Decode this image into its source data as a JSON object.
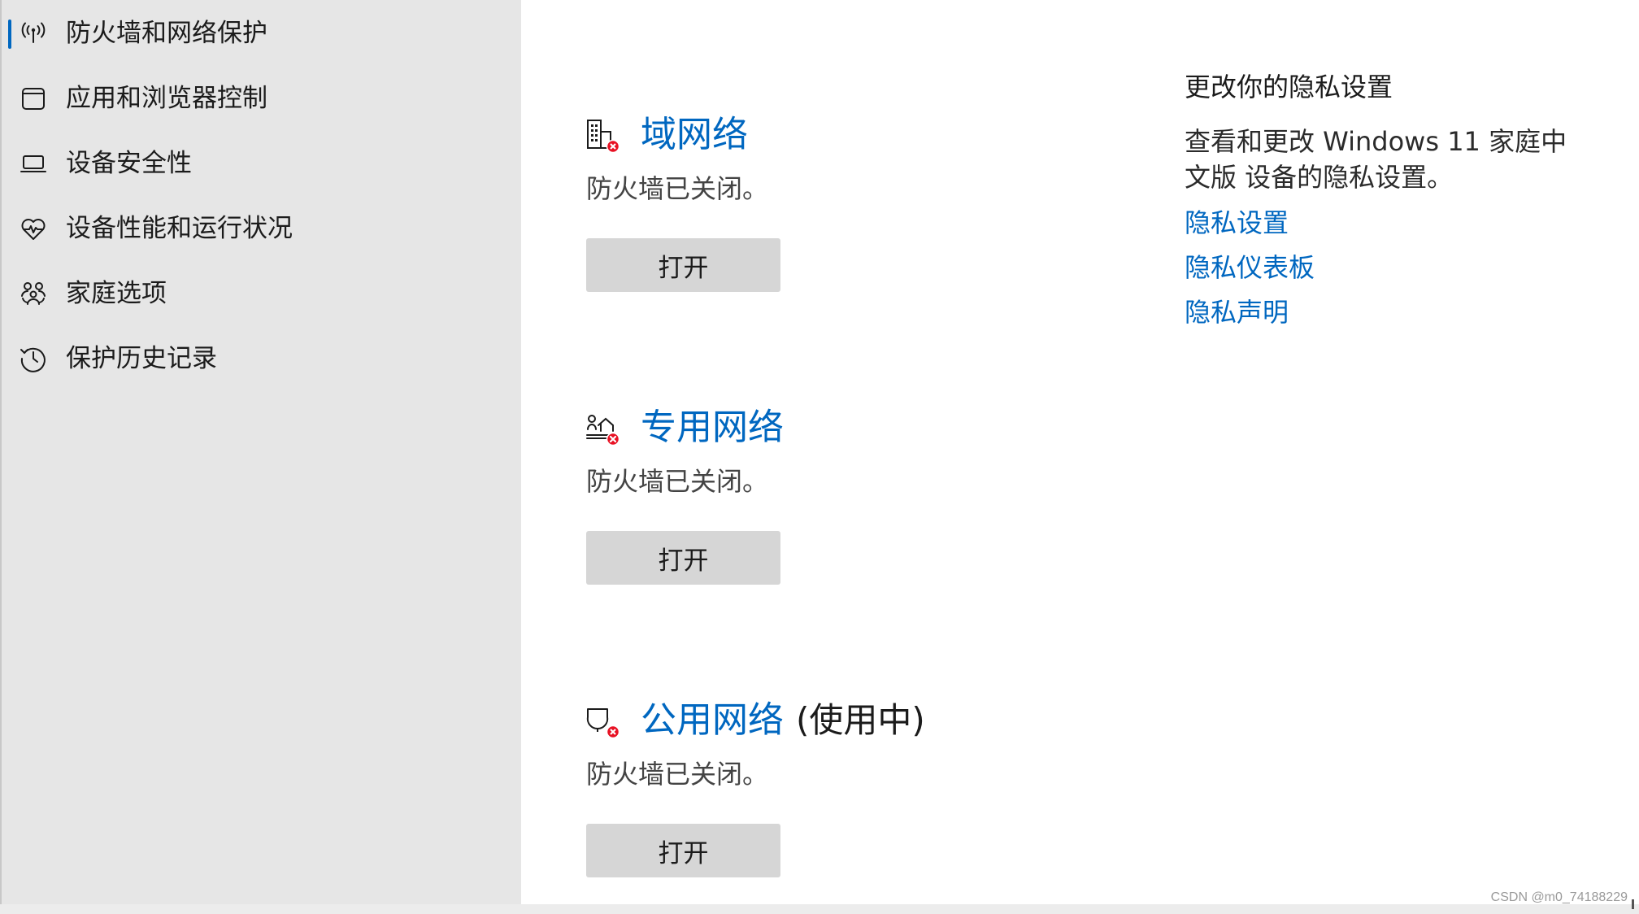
{
  "colors": {
    "accent": "#0067c0",
    "sidebar_bg": "#e6e6e6",
    "button_bg": "#d6d6d6",
    "error_badge": "#e81123"
  },
  "sidebar": {
    "items": [
      {
        "label": "防火墙和网络保护",
        "icon": "antenna-icon",
        "selected": true
      },
      {
        "label": "应用和浏览器控制",
        "icon": "browser-window-icon",
        "selected": false
      },
      {
        "label": "设备安全性",
        "icon": "laptop-icon",
        "selected": false
      },
      {
        "label": "设备性能和运行状况",
        "icon": "heart-pulse-icon",
        "selected": false
      },
      {
        "label": "家庭选项",
        "icon": "family-icon",
        "selected": false
      },
      {
        "label": "保护历史记录",
        "icon": "history-icon",
        "selected": false
      }
    ]
  },
  "networks": [
    {
      "title": "域网络",
      "suffix": "",
      "status": "防火墙已关闭。",
      "button_label": "打开",
      "icon": "domain-network-error-icon"
    },
    {
      "title": "专用网络",
      "suffix": "",
      "status": "防火墙已关闭。",
      "button_label": "打开",
      "icon": "private-network-error-icon"
    },
    {
      "title": "公用网络",
      "suffix": "(使用中)",
      "status": "防火墙已关闭。",
      "button_label": "打开",
      "icon": "public-network-error-icon"
    }
  ],
  "privacy": {
    "heading": "更改你的隐私设置",
    "description": "查看和更改 Windows 11 家庭中文版 设备的隐私设置。",
    "links": [
      "隐私设置",
      "隐私仪表板",
      "隐私声明"
    ]
  },
  "watermark": "CSDN @m0_74188229"
}
